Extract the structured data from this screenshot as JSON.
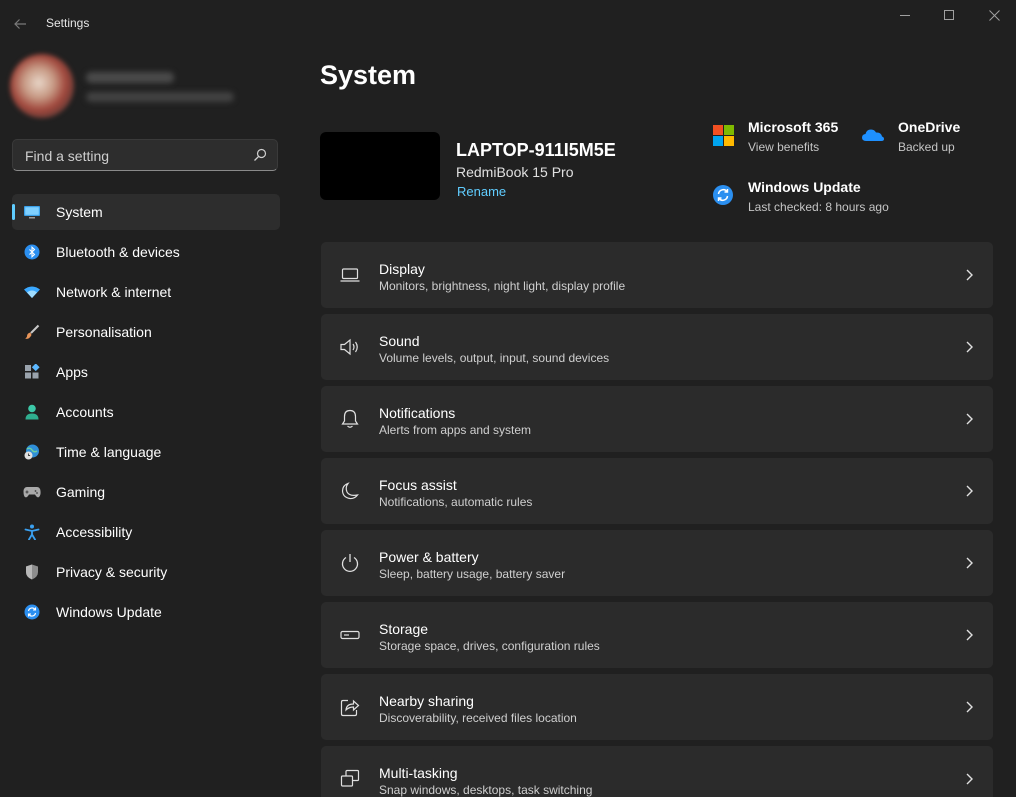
{
  "app": {
    "title": "Settings"
  },
  "window_controls": [
    "minimize",
    "maximize",
    "close"
  ],
  "search": {
    "placeholder": "Find a setting"
  },
  "sidebar": {
    "items": [
      {
        "label": "System",
        "icon": "monitor-icon",
        "active": true
      },
      {
        "label": "Bluetooth & devices",
        "icon": "bluetooth-icon"
      },
      {
        "label": "Network & internet",
        "icon": "wifi-icon"
      },
      {
        "label": "Personalisation",
        "icon": "brush-icon"
      },
      {
        "label": "Apps",
        "icon": "apps-icon"
      },
      {
        "label": "Accounts",
        "icon": "person-icon"
      },
      {
        "label": "Time & language",
        "icon": "globe-clock-icon"
      },
      {
        "label": "Gaming",
        "icon": "gamepad-icon"
      },
      {
        "label": "Accessibility",
        "icon": "accessibility-icon"
      },
      {
        "label": "Privacy & security",
        "icon": "shield-icon"
      },
      {
        "label": "Windows Update",
        "icon": "update-icon"
      }
    ]
  },
  "page": {
    "title": "System"
  },
  "device": {
    "name": "LAPTOP-911I5M5E",
    "model": "RedmiBook 15 Pro",
    "rename_label": "Rename"
  },
  "quick_links": [
    {
      "title": "Microsoft 365",
      "subtitle": "View benefits",
      "icon": "microsoft-logo-icon"
    },
    {
      "title": "OneDrive",
      "subtitle": "Backed up",
      "icon": "cloud-icon"
    },
    {
      "title": "Windows Update",
      "subtitle": "Last checked: 8 hours ago",
      "icon": "update-icon"
    }
  ],
  "cards": [
    {
      "title": "Display",
      "subtitle": "Monitors, brightness, night light, display profile",
      "icon": "laptop-icon"
    },
    {
      "title": "Sound",
      "subtitle": "Volume levels, output, input, sound devices",
      "icon": "speaker-icon"
    },
    {
      "title": "Notifications",
      "subtitle": "Alerts from apps and system",
      "icon": "bell-icon"
    },
    {
      "title": "Focus assist",
      "subtitle": "Notifications, automatic rules",
      "icon": "moon-icon"
    },
    {
      "title": "Power & battery",
      "subtitle": "Sleep, battery usage, battery saver",
      "icon": "power-icon"
    },
    {
      "title": "Storage",
      "subtitle": "Storage space, drives, configuration rules",
      "icon": "drive-icon"
    },
    {
      "title": "Nearby sharing",
      "subtitle": "Discoverability, received files location",
      "icon": "share-icon"
    },
    {
      "title": "Multi-tasking",
      "subtitle": "Snap windows, desktops, task switching",
      "icon": "windows-stack-icon"
    }
  ],
  "colors": {
    "background": "#202020",
    "card": "#2b2b2b",
    "accent": "#60cdff"
  }
}
